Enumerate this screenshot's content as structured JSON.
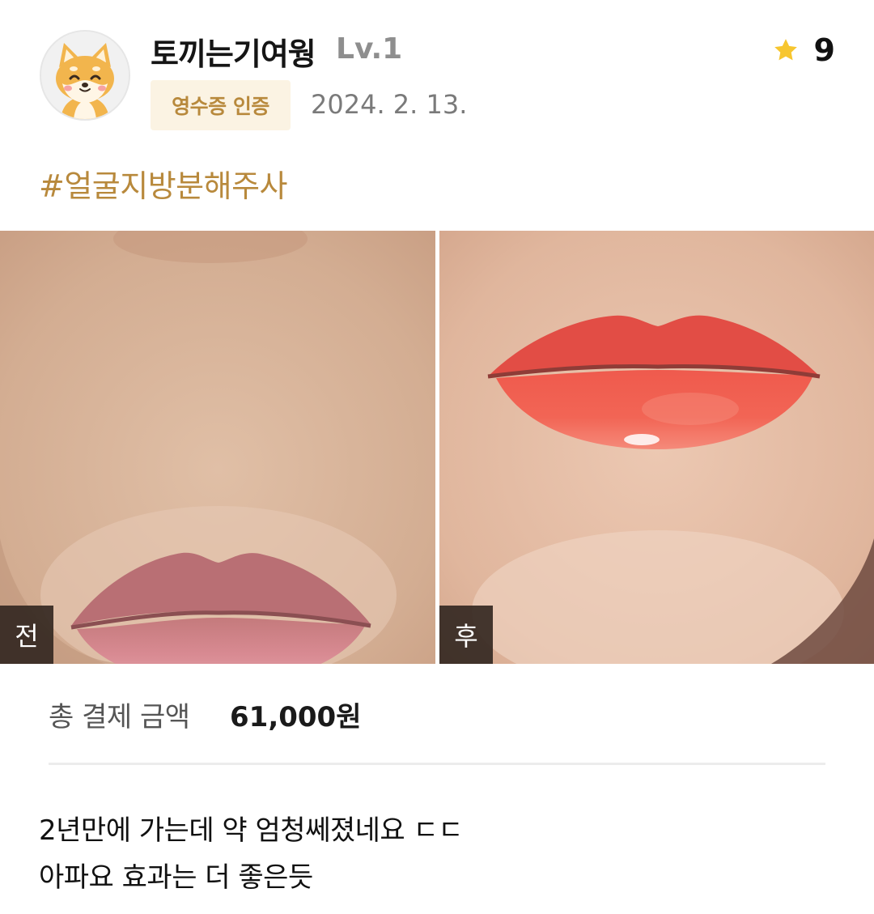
{
  "author": {
    "name": "토끼는기여웡",
    "level": "Lv.1",
    "avatar_icon": "shiba-dog-avatar-icon"
  },
  "rating": {
    "icon": "star-icon",
    "value": "9",
    "color": "#f7c62f"
  },
  "verification_badge": "영수증 인증",
  "date": "2024. 2. 13.",
  "hashtag": "#얼굴지방분해주사",
  "photos": {
    "before_label": "전",
    "after_label": "후"
  },
  "payment": {
    "label": "총 결제 금액",
    "amount": "61,000원"
  },
  "review_lines": [
    "2년만에 가는데 약 엄청쎄졌네요 ㄷㄷ",
    "아파요 효과는 더 좋은듯"
  ],
  "colors": {
    "accent": "#b8893c",
    "badge_bg": "#fbf3e3"
  }
}
